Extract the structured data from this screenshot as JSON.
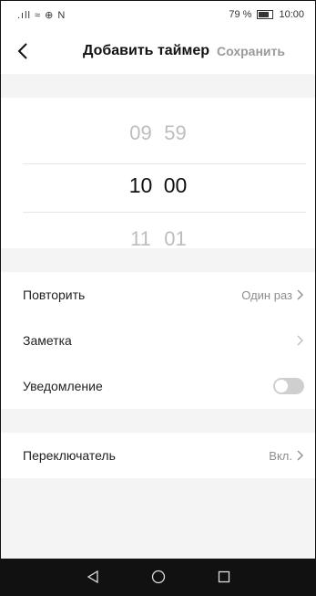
{
  "status_bar": {
    "signal_icons": ".ıll ≈ ⊕ N",
    "battery_percent": "79 %",
    "time": "10:00"
  },
  "header": {
    "title": "Добавить таймер",
    "save_label": "Сохранить"
  },
  "time_picker": {
    "previous": {
      "hour": "09",
      "minute": "59"
    },
    "selected": {
      "hour": "10",
      "minute": "00"
    },
    "next": {
      "hour": "11",
      "minute": "01"
    }
  },
  "settings": [
    {
      "label": "Повторить",
      "value": "Один раз"
    },
    {
      "label": "Заметка",
      "value": ""
    },
    {
      "label": "Уведомление",
      "toggle": false
    }
  ],
  "switch_setting": {
    "label": "Переключатель",
    "value": "Вкл."
  },
  "colors": {
    "accent_save": "#9a9a9a",
    "toggle_off": "#cfcfcf",
    "background": "#f4f4f4"
  },
  "icons": [
    "back-chevron-icon",
    "chevron-right-icon",
    "nav-back-icon",
    "nav-home-icon",
    "nav-recent-icon"
  ]
}
